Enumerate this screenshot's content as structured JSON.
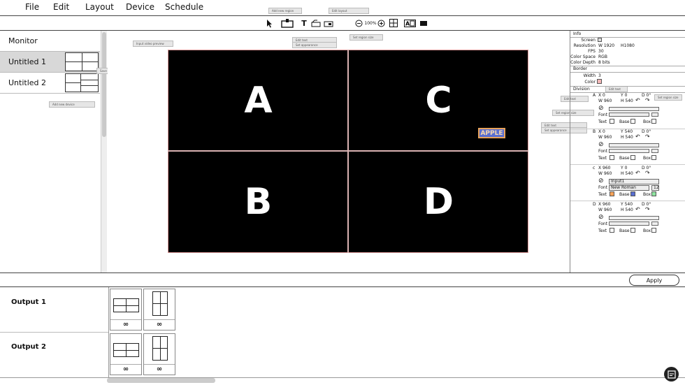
{
  "menu": {
    "items": [
      "File",
      "Edit",
      "Layout",
      "Device",
      "Schedule"
    ]
  },
  "toolbar": {
    "zoom": "100%",
    "text_tool": "T"
  },
  "tooltips": {
    "add_region": "Add new region",
    "edit_layout": "Edit layout",
    "input_video": "Input video preview",
    "edit_text": "Edit text",
    "set_appearance": "Set appearance",
    "set_region": "Set region size",
    "save_layout": "Save layout",
    "add_new_device": "Add new device"
  },
  "sidebar": {
    "items": [
      {
        "label": "Monitor"
      },
      {
        "label": "Untitled 1"
      },
      {
        "label": "Untitled 2"
      }
    ]
  },
  "canvas": {
    "cells": [
      "A",
      "C",
      "B",
      "D"
    ],
    "tag": "APPLE"
  },
  "info": {
    "title": "Info",
    "screen_label": "Screen",
    "resolution_label": "Resolution",
    "resolution_w": "W 1920",
    "resolution_h": "H1080",
    "fps_label": "FPS",
    "fps": "30",
    "color_space_label": "Color Space",
    "color_space": "RGB",
    "color_depth_label": "Color Depth",
    "color_depth": "8 bits"
  },
  "border": {
    "title": "Border",
    "width_label": "Width",
    "width": "3",
    "color_label": "Color",
    "color": "#f4b8b8"
  },
  "division": {
    "title": "Division",
    "font_label": "Font",
    "text_label": "Text",
    "base_label": "Base",
    "box_label": "Box",
    "items": [
      {
        "id": "A",
        "x": "X 0",
        "y": "Y 0",
        "d": "D 0°",
        "w": "W 960",
        "h": "H 540"
      },
      {
        "id": "B",
        "x": "X 0",
        "y": "Y 540",
        "d": "D 0°",
        "w": "W 960",
        "h": "H 540"
      },
      {
        "id": "c",
        "x": "X 960",
        "y": "Y 0",
        "d": "D 0°",
        "w": "W 960",
        "h": "H 540",
        "input": "Input1",
        "font": "New Roman",
        "size": "12"
      },
      {
        "id": "D",
        "x": "X 960",
        "y": "Y 540",
        "d": "D 0°",
        "w": "W 960",
        "h": "H 540"
      }
    ]
  },
  "apply": {
    "label": "Apply"
  },
  "outputs": {
    "items": [
      {
        "label": "Output 1",
        "cards": [
          "∞",
          "∞"
        ]
      },
      {
        "label": "Output 2",
        "cards": [
          "∞",
          "∞"
        ]
      }
    ]
  },
  "colors": {
    "accent_orange": "#f5a35a",
    "accent_blue": "#5a6fd1",
    "accent_green": "#8fe3a0"
  }
}
